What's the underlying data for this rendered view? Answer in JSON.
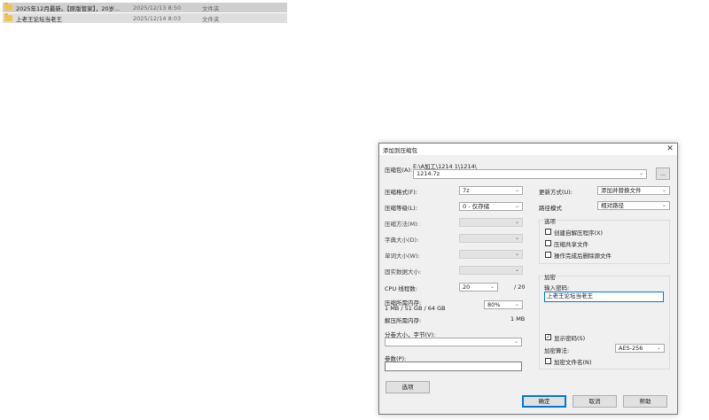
{
  "explorer": {
    "rows": [
      {
        "name": "2025年12月最新。【原版管家】，20岁...",
        "date": "2025/12/13 8:50",
        "type": "文件夹"
      },
      {
        "name": "上老王论坛当老王",
        "date": "2025/12/14 8:03",
        "type": "文件夹"
      }
    ]
  },
  "dialog": {
    "title": "添加到压缩包",
    "archive_label": "压缩包(A):",
    "archive_path": "E:\\A加工\\1214 1\\1214\\",
    "archive_name": "1214.7z",
    "browse_label": "...",
    "format_label": "压缩格式(F):",
    "format_value": "7z",
    "level_label": "压缩等级(L):",
    "level_value": "0 - 仅存储",
    "method_label": "压缩方法(M):",
    "dict_label": "字典大小(D):",
    "word_label": "单词大小(W):",
    "solid_label": "固实数据大小:",
    "cpu_label": "CPU 线程数:",
    "cpu_value": "20",
    "cpu_max": "/ 20",
    "mem_label": "压缩所需内存:",
    "mem_detail": "1 MB / 51 GB / 64 GB",
    "mem_value": "80%",
    "decomp_label": "解压所需内存:",
    "decomp_value": "1 MB",
    "split_label": "分卷大小，字节(V):",
    "params_label": "参数(P):",
    "options_button": "选项",
    "update_label": "更新方式(U):",
    "update_value": "添加并替换文件",
    "path_label": "路径模式",
    "path_value": "相对路径",
    "options_group": "选项",
    "opt_sfx": "创建自解压程序(X)",
    "opt_shared": "压缩共享文件",
    "opt_delete": "操作完成后删除源文件",
    "encrypt_group": "加密",
    "password_label": "输入密码:",
    "password_value": "上老王论坛当老王",
    "show_password": "显示密码(S)",
    "enc_method_label": "加密算法:",
    "enc_method_value": "AES-256",
    "encrypt_names": "加密文件名(N)",
    "ok": "确定",
    "cancel": "取消",
    "help": "帮助"
  },
  "icons": {
    "close": "close-icon",
    "dropdown": "chevron-down-icon",
    "folder": "folder-icon",
    "check": "checkmark-icon"
  },
  "colors": {
    "accent": "#0078d7",
    "folder": "#f3c350",
    "dialog_bg": "#f0f0f0"
  }
}
